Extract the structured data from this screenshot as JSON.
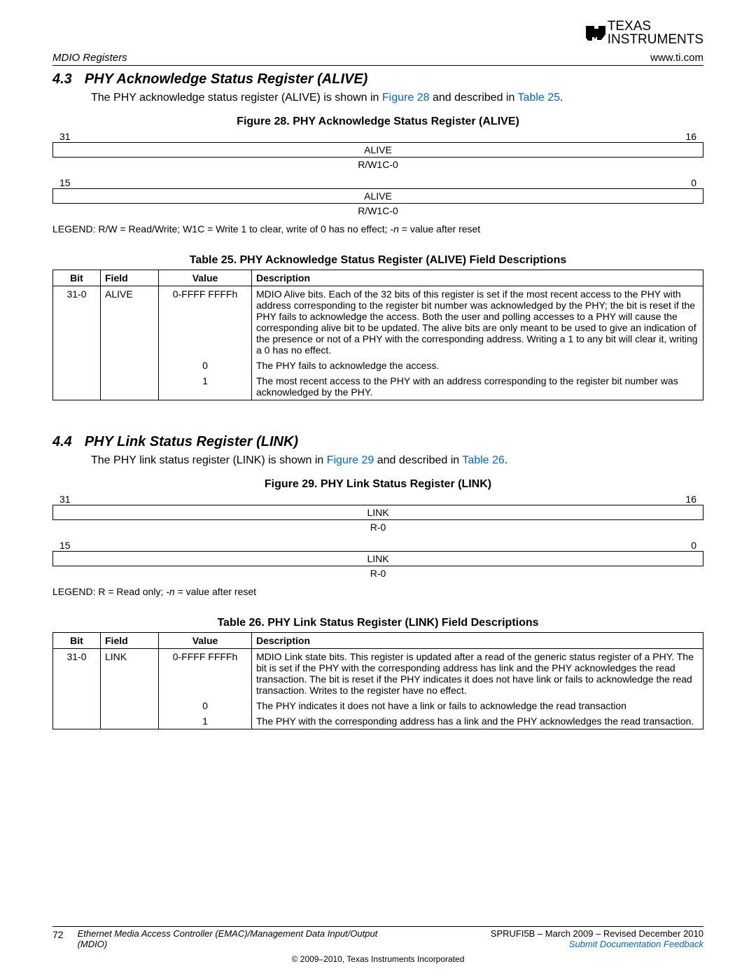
{
  "header": {
    "left": "MDIO Registers",
    "right": "www.ti.com",
    "logo_top": "TEXAS",
    "logo_bottom": "INSTRUMENTS"
  },
  "sec43": {
    "num": "4.3",
    "title": "PHY Acknowledge Status Register (ALIVE)",
    "intro_a": "The PHY acknowledge status register (ALIVE) is shown in ",
    "fig_ref": "Figure 28",
    "intro_b": " and described in ",
    "tbl_ref": "Table 25",
    "intro_c": "."
  },
  "fig28": {
    "title": "Figure 28. PHY Acknowledge Status Register (ALIVE)",
    "bit_hi_l": "31",
    "bit_hi_r": "16",
    "row1_name": "ALIVE",
    "row1_access": "R/W1C-0",
    "bit_lo_l": "15",
    "bit_lo_r": "0",
    "row2_name": "ALIVE",
    "row2_access": "R/W1C-0",
    "legend_a": "LEGEND: R/W = Read/Write; W1C = Write 1 to clear, write of 0 has no effect;  ",
    "legend_ital": "-n ",
    "legend_b": "= value after reset"
  },
  "tbl25": {
    "title": "Table 25. PHY Acknowledge Status Register (ALIVE) Field Descriptions",
    "h_bit": "Bit",
    "h_field": "Field",
    "h_value": "Value",
    "h_desc": "Description",
    "r1_bit": "31-0",
    "r1_field": "ALIVE",
    "r1_value": "0-FFFF FFFFh",
    "r1_desc": "MDIO Alive bits. Each of the 32 bits of this register is set if the most recent access to the PHY with address corresponding to the register bit number was acknowledged by the PHY; the bit is reset if the PHY fails to acknowledge the access. Both the user and polling accesses to a PHY will cause the corresponding alive bit to be updated. The alive bits are only meant to be used to give an indication of the presence or not of a PHY with the corresponding address. Writing a 1 to any bit will clear it, writing a 0 has no effect.",
    "r2_value": "0",
    "r2_desc": "The PHY fails to acknowledge the access.",
    "r3_value": "1",
    "r3_desc": "The most recent access to the PHY with an address corresponding to the register bit number was acknowledged by the PHY."
  },
  "sec44": {
    "num": "4.4",
    "title": "PHY Link Status Register (LINK)",
    "intro_a": "The PHY link status register (LINK) is shown in ",
    "fig_ref": "Figure 29",
    "intro_b": " and described in ",
    "tbl_ref": "Table 26",
    "intro_c": "."
  },
  "fig29": {
    "title": "Figure 29. PHY Link Status Register (LINK)",
    "bit_hi_l": "31",
    "bit_hi_r": "16",
    "row1_name": "LINK",
    "row1_access": "R-0",
    "bit_lo_l": "15",
    "bit_lo_r": "0",
    "row2_name": "LINK",
    "row2_access": "R-0",
    "legend_a": "LEGEND: R = Read only;  ",
    "legend_ital": "-n ",
    "legend_b": "= value after reset"
  },
  "tbl26": {
    "title": "Table 26. PHY Link Status Register (LINK) Field Descriptions",
    "h_bit": "Bit",
    "h_field": "Field",
    "h_value": "Value",
    "h_desc": "Description",
    "r1_bit": "31-0",
    "r1_field": "LINK",
    "r1_value": "0-FFFF FFFFh",
    "r1_desc": "MDIO Link state bits. This register is updated after a read of the generic status register of a PHY. The bit is set if the PHY with the corresponding address has link and the PHY acknowledges the read transaction. The bit is reset if the PHY indicates it does not have link or fails to acknowledge the read transaction. Writes to the register have no effect.",
    "r2_value": "0",
    "r2_desc": "The PHY indicates it does not have a link or fails to acknowledge the read transaction",
    "r3_value": "1",
    "r3_desc": "The PHY with the corresponding address has a link and the PHY acknowledges the read transaction."
  },
  "footer": {
    "page": "72",
    "doc": "Ethernet Media Access Controller (EMAC)/Management Data Input/Output (MDIO)",
    "right1": "SPRUFI5B – March 2009 – Revised December 2010",
    "right2": "Submit Documentation Feedback",
    "copyright": "© 2009–2010, Texas Instruments Incorporated"
  }
}
